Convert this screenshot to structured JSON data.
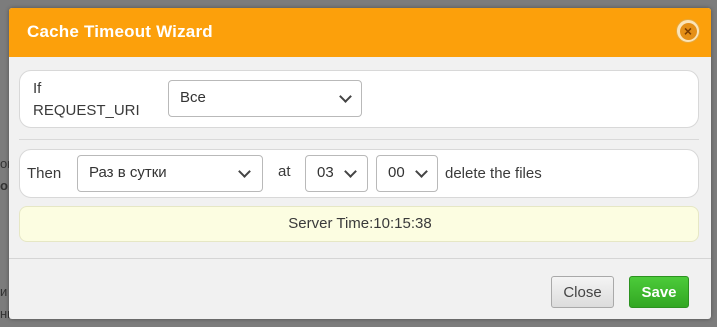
{
  "dialog": {
    "title": "Cache Timeout Wizard"
  },
  "condition": {
    "if_label_1": "If",
    "if_label_2": "REQUEST_URI",
    "match_value": "Все"
  },
  "schedule": {
    "then_label": "Then",
    "frequency_value": "Раз в сутки",
    "at_label": "at",
    "hour_value": "03",
    "minute_value": "00",
    "action_text": "delete the files"
  },
  "server": {
    "time_text": "Server Time:10:15:38"
  },
  "buttons": {
    "close_label": "Close",
    "save_label": "Save"
  },
  "background_fragments": {
    "frag_left_1": "ов",
    "frag_left_2": "о",
    "frag_left_3": "и",
    "frag_left_4": "нн"
  },
  "colors": {
    "titlebar": "#fca00b",
    "save": "#3bb62b",
    "server_time_bg": "#fcfde1"
  }
}
